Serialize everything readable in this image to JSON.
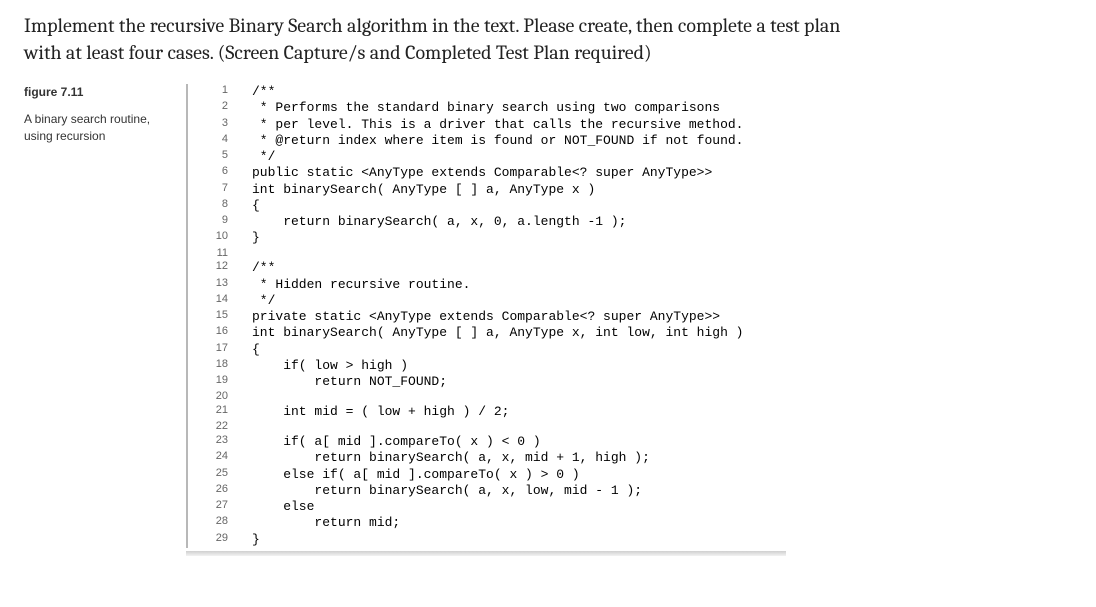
{
  "prompt": {
    "line1": "Implement the recursive Binary Search algorithm in the text.  Please create, then complete a test plan",
    "line2": "with at least four cases.  (Screen Capture/s and Completed Test Plan required)"
  },
  "figure": {
    "label": "figure 7.11",
    "caption": "A binary search routine, using recursion"
  },
  "code": {
    "lines": [
      {
        "n": "1",
        "t": "/**"
      },
      {
        "n": "2",
        "t": " * Performs the standard binary search using two comparisons"
      },
      {
        "n": "3",
        "t": " * per level. This is a driver that calls the recursive method."
      },
      {
        "n": "4",
        "t": " * @return index where item is found or NOT_FOUND if not found."
      },
      {
        "n": "5",
        "t": " */"
      },
      {
        "n": "6",
        "t": "public static <AnyType extends Comparable<? super AnyType>>"
      },
      {
        "n": "7",
        "t": "int binarySearch( AnyType [ ] a, AnyType x )"
      },
      {
        "n": "8",
        "t": "{"
      },
      {
        "n": "9",
        "t": "    return binarySearch( a, x, 0, a.length -1 );"
      },
      {
        "n": "10",
        "t": "}"
      },
      {
        "n": "11",
        "t": ""
      },
      {
        "n": "12",
        "t": "/**"
      },
      {
        "n": "13",
        "t": " * Hidden recursive routine."
      },
      {
        "n": "14",
        "t": " */"
      },
      {
        "n": "15",
        "t": "private static <AnyType extends Comparable<? super AnyType>>"
      },
      {
        "n": "16",
        "t": "int binarySearch( AnyType [ ] a, AnyType x, int low, int high )"
      },
      {
        "n": "17",
        "t": "{"
      },
      {
        "n": "18",
        "t": "    if( low > high )"
      },
      {
        "n": "19",
        "t": "        return NOT_FOUND;"
      },
      {
        "n": "20",
        "t": ""
      },
      {
        "n": "21",
        "t": "    int mid = ( low + high ) / 2;"
      },
      {
        "n": "22",
        "t": ""
      },
      {
        "n": "23",
        "t": "    if( a[ mid ].compareTo( x ) < 0 )"
      },
      {
        "n": "24",
        "t": "        return binarySearch( a, x, mid + 1, high );"
      },
      {
        "n": "25",
        "t": "    else if( a[ mid ].compareTo( x ) > 0 )"
      },
      {
        "n": "26",
        "t": "        return binarySearch( a, x, low, mid - 1 );"
      },
      {
        "n": "27",
        "t": "    else"
      },
      {
        "n": "28",
        "t": "        return mid;"
      },
      {
        "n": "29",
        "t": "}"
      }
    ]
  }
}
